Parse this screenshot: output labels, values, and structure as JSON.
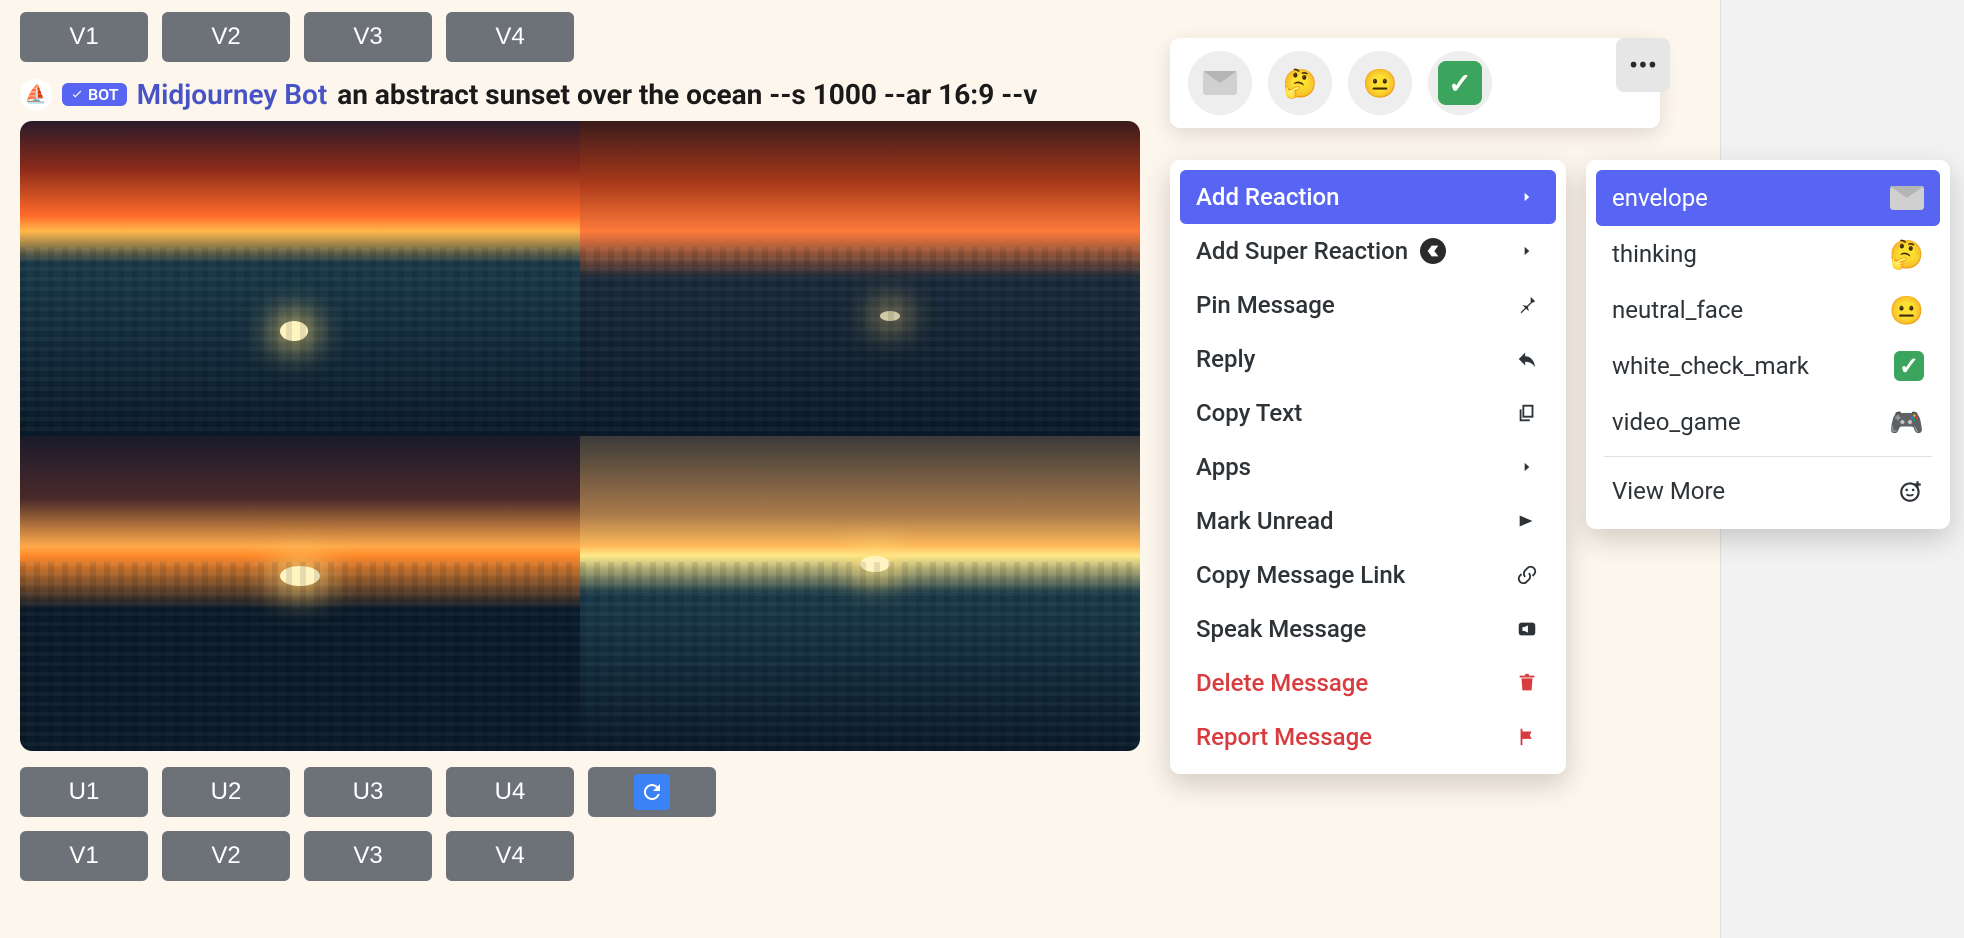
{
  "topButtons": {
    "v1": "V1",
    "v2": "V2",
    "v3": "V3",
    "v4": "V4"
  },
  "message": {
    "botBadge": "BOT",
    "botName": "Midjourney Bot",
    "prompt": "an abstract sunset over the ocean --s 1000 --ar 16:9 --v"
  },
  "bottomButtonsRow1": {
    "u1": "U1",
    "u2": "U2",
    "u3": "U3",
    "u4": "U4"
  },
  "bottomButtonsRow2": {
    "v1": "V1",
    "v2": "V2",
    "v3": "V3",
    "v4": "V4"
  },
  "reactionBar": {
    "envelope": "envelope-icon",
    "thinking": "🤔",
    "neutral": "😐",
    "check": "✓",
    "more": "⋯"
  },
  "contextMenu": {
    "addReaction": "Add Reaction",
    "addSuperReaction": "Add Super Reaction",
    "pinMessage": "Pin Message",
    "reply": "Reply",
    "copyText": "Copy Text",
    "apps": "Apps",
    "markUnread": "Mark Unread",
    "copyMessageLink": "Copy Message Link",
    "speakMessage": "Speak Message",
    "deleteMessage": "Delete Message",
    "reportMessage": "Report Message"
  },
  "reactionSubmenu": {
    "envelope": "envelope",
    "thinking": "thinking",
    "neutral_face": "neutral_face",
    "white_check_mark": "white_check_mark",
    "video_game": "video_game",
    "viewMore": "View More"
  }
}
